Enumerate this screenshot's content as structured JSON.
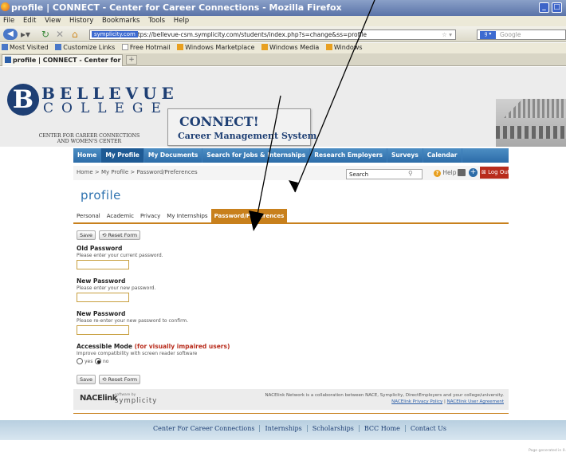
{
  "browser": {
    "window_title": "profile | CONNECT - Center for Career Connections - Mozilla Firefox",
    "menu": [
      "File",
      "Edit",
      "View",
      "History",
      "Bookmarks",
      "Tools",
      "Help"
    ],
    "site_badge": "symplicity.com",
    "url": "https://bellevue-csm.symplicity.com/students/index.php?s=change&ss=profile",
    "search_engine": "Google",
    "bookmarks": [
      "Most Visited",
      "Customize Links",
      "Free Hotmail",
      "Windows Marketplace",
      "Windows Media",
      "Windows"
    ],
    "tab_title": "profile | CONNECT - Center for C..."
  },
  "header": {
    "logo_letter": "B",
    "college_name_1": "BELLEVUE",
    "college_name_2": "COLLEGE",
    "center_name": "CENTER FOR CAREER CONNECTIONS",
    "center_name_2": "AND WOMEN'S CENTER",
    "connect_title": "CONNECT!",
    "connect_subtitle": "Career Management System"
  },
  "nav": {
    "items": [
      "Home",
      "My Profile",
      "My Documents",
      "Search for Jobs & Internships",
      "Research Employers",
      "Surveys",
      "Calendar"
    ],
    "active_index": 1
  },
  "toolbar": {
    "breadcrumb": "Home > My Profile > Password/Preferences",
    "search_value": "Search",
    "help_label": "Help",
    "logout_label": "Log Out"
  },
  "page_title": "profile",
  "subtabs": {
    "items": [
      "Personal",
      "Academic",
      "Privacy",
      "My Internships",
      "Password/Preferences"
    ],
    "active_index": 4
  },
  "form": {
    "save_label": "Save",
    "reset_label": "Reset Form",
    "old_password_label": "Old Password",
    "old_password_hint": "Please enter your current password.",
    "new_password_label": "New Password",
    "new_password_hint": "Please enter your new password.",
    "confirm_password_label": "New Password",
    "confirm_password_hint": "Please re-enter your new password to confirm.",
    "accessible_label": "Accessible Mode",
    "accessible_label_red": "(for visually impaired users)",
    "accessible_hint": "Improve compatibility with screen reader software",
    "radio_yes": "yes",
    "radio_no": "no",
    "selected": "no"
  },
  "footer": {
    "nace_logo": "NACElink",
    "software_by": "software by",
    "symplicity_logo": "symplicity",
    "note": "NACElink Network is a collaboration between NACE, Symplicity, DirectEmployers and your college/university.",
    "privacy_link": "NACElink Privacy Policy",
    "separator": "|",
    "user_agreement_link": "NACElink User Agreement"
  },
  "bottom_links": [
    "Center For Career Connections",
    "Internships",
    "Scholarships",
    "BCC Home",
    "Contact Us"
  ],
  "page_generated": "Page generated in 0."
}
